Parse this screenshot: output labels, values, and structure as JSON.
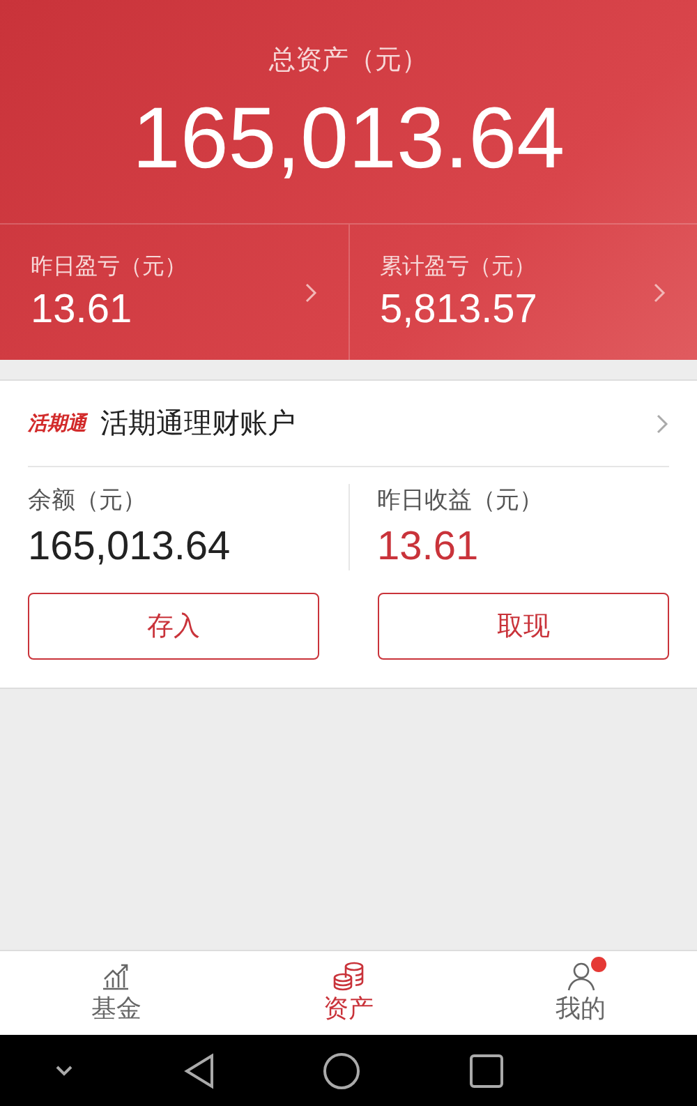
{
  "summary": {
    "title": "总资产（元）",
    "total": "165,013.64",
    "stats": [
      {
        "label": "昨日盈亏（元）",
        "value": "13.61"
      },
      {
        "label": "累计盈亏（元）",
        "value": "5,813.57"
      }
    ]
  },
  "account": {
    "logo": "活期通",
    "title": "活期通理财账户",
    "fields": [
      {
        "label": "余额（元）",
        "value": "165,013.64",
        "highlight": false
      },
      {
        "label": "昨日收益（元）",
        "value": "13.61",
        "highlight": true
      }
    ],
    "buttons": [
      "存入",
      "取现"
    ]
  },
  "tabbar": [
    {
      "kind": "chart",
      "label": "基金",
      "selected": false,
      "badge": false
    },
    {
      "kind": "coins",
      "label": "资产",
      "selected": true,
      "badge": false
    },
    {
      "kind": "person",
      "label": "我的",
      "selected": false,
      "badge": true
    }
  ]
}
